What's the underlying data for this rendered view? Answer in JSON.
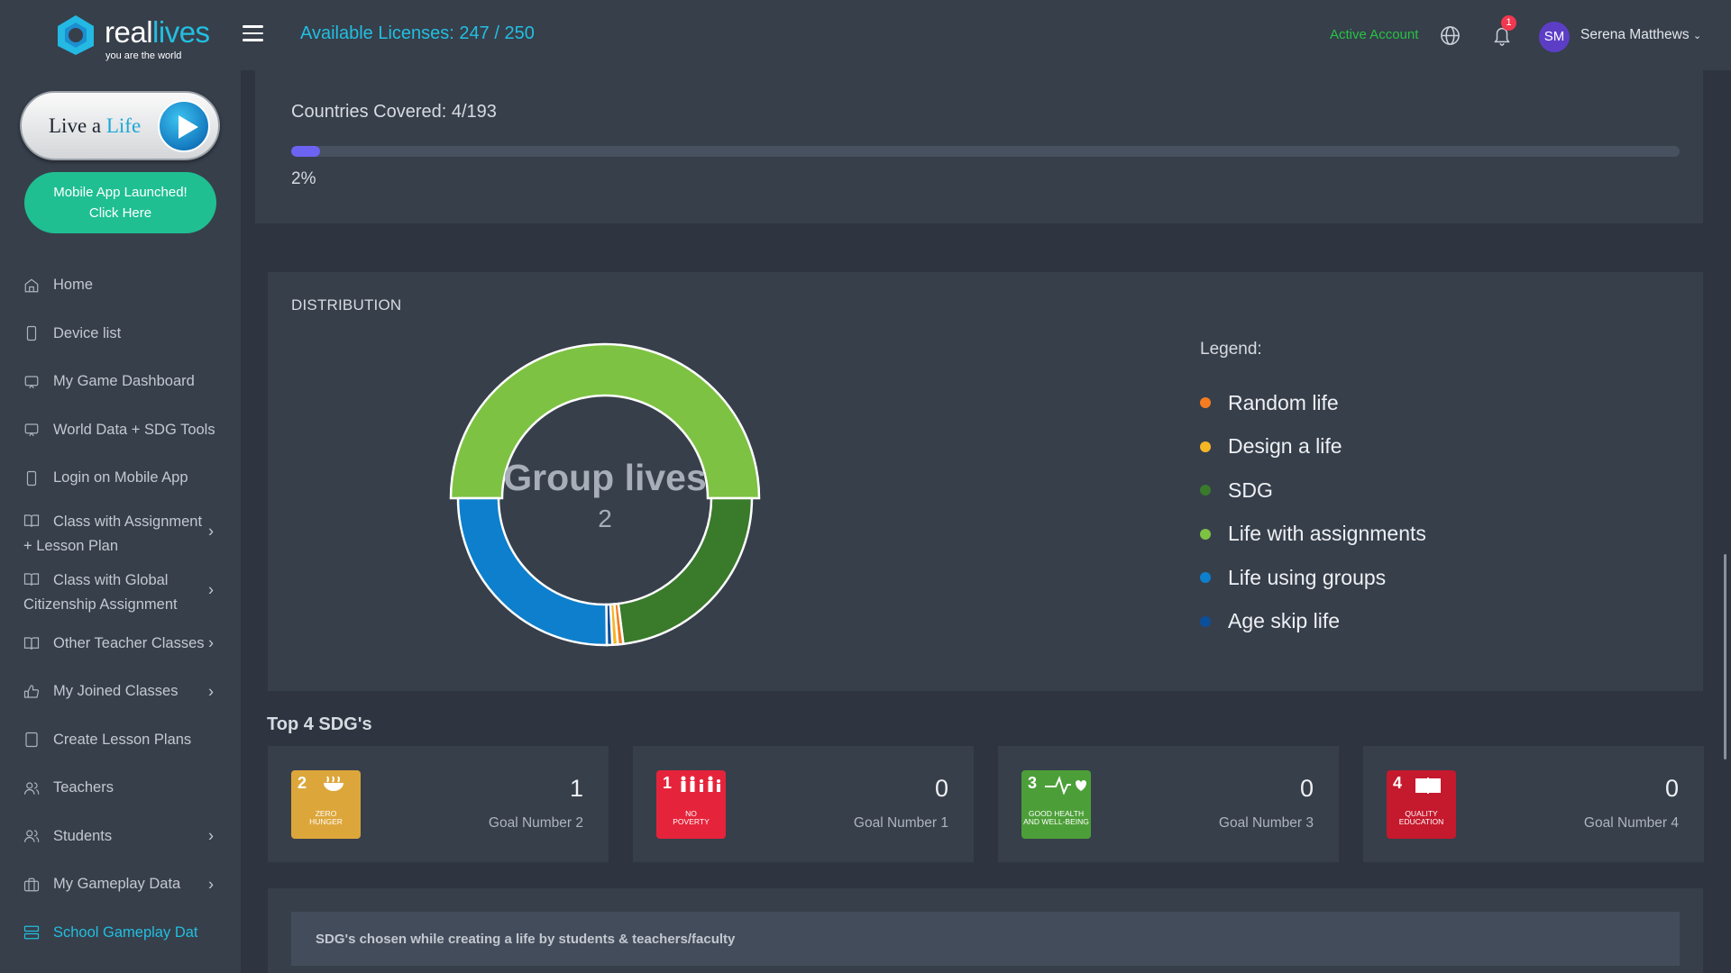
{
  "brand": {
    "name_part1": "real",
    "name_part2": "lives",
    "tagline": "you are the world"
  },
  "sidebar": {
    "live_button": {
      "label_part1": "Live a ",
      "label_part2": "Life"
    },
    "mobile_button": {
      "line1": "Mobile App Launched!",
      "line2": "Click Here"
    },
    "items": [
      {
        "label": "Home",
        "icon": "home-icon"
      },
      {
        "label": "Device list",
        "icon": "device-icon"
      },
      {
        "label": "My Game Dashboard",
        "icon": "monitor-icon"
      },
      {
        "label": "World Data + SDG Tools",
        "icon": "monitor-icon"
      },
      {
        "label": "Login on Mobile App",
        "icon": "mobile-icon"
      },
      {
        "label": "Class with Assignment",
        "label2": "+ Lesson Plan",
        "icon": "book-icon",
        "chevron": true
      },
      {
        "label": "Class with Global",
        "label2": "Citizenship Assignment",
        "icon": "book-icon",
        "chevron": true
      },
      {
        "label": "Other Teacher Classes",
        "icon": "book-icon",
        "chevron": true
      },
      {
        "label": "My Joined Classes",
        "icon": "thumbs-up-icon",
        "chevron": true
      },
      {
        "label": "Create Lesson Plans",
        "icon": "tablet-icon"
      },
      {
        "label": "Teachers",
        "icon": "users-icon"
      },
      {
        "label": "Students",
        "icon": "users-icon",
        "chevron": true
      },
      {
        "label": "My Gameplay Data",
        "icon": "briefcase-icon",
        "chevron": true
      },
      {
        "label": "School Gameplay Dat",
        "icon": "server-icon",
        "active": true
      }
    ]
  },
  "topbar": {
    "licenses": "Available Licenses: 247 / 250",
    "account_status": "Active Account",
    "notification_count": "1",
    "user_initials": "SM",
    "user_name": "Serena Matthews"
  },
  "countries": {
    "title": "Countries Covered: 4/193",
    "percent_label": "2%",
    "progress_fraction": 0.021
  },
  "distribution": {
    "title": "DISTRIBUTION",
    "center_title": "Group lives",
    "center_value": "2",
    "legend_heading": "Legend:",
    "legend": [
      {
        "label": "Random life",
        "color": "#f57c20"
      },
      {
        "label": "Design a life",
        "color": "#f5b626"
      },
      {
        "label": "SDG",
        "color": "#3a7a2b"
      },
      {
        "label": "Life with assignments",
        "color": "#7dc242"
      },
      {
        "label": "Life using groups",
        "color": "#0e7fcc"
      },
      {
        "label": "Age skip life",
        "color": "#0b4e9a"
      }
    ]
  },
  "chart_data": {
    "type": "pie",
    "title": "DISTRIBUTION",
    "series": [
      {
        "name": "Life with assignments",
        "value": 50,
        "color": "#7dc242"
      },
      {
        "name": "SDG",
        "value": 23,
        "color": "#3a7a2b"
      },
      {
        "name": "Random life",
        "value": 0.6,
        "color": "#f57c20"
      },
      {
        "name": "Design a life",
        "value": 0.6,
        "color": "#f5b626"
      },
      {
        "name": "Age skip life",
        "value": 0.6,
        "color": "#0b4e9a"
      },
      {
        "name": "Life using groups",
        "value": 25.2,
        "color": "#0e7fcc"
      }
    ],
    "highlighted": "Life with assignments"
  },
  "top_sdgs": {
    "title": "Top 4 SDG's",
    "cards": [
      {
        "sdg_number": "2",
        "sdg_name_line1": "ZERO",
        "sdg_name_line2": "HUNGER",
        "color": "#dda63a",
        "value": "1",
        "label": "Goal Number 2",
        "icon": "bowl-icon"
      },
      {
        "sdg_number": "1",
        "sdg_name_line1": "NO",
        "sdg_name_line2": "POVERTY",
        "color": "#e5243b",
        "value": "0",
        "label": "Goal Number 1",
        "icon": "family-icon"
      },
      {
        "sdg_number": "3",
        "sdg_name_line1": "GOOD HEALTH",
        "sdg_name_line2": "AND WELL-BEING",
        "color": "#4c9f38",
        "value": "0",
        "label": "Goal Number 3",
        "icon": "heartbeat-icon"
      },
      {
        "sdg_number": "4",
        "sdg_name_line1": "QUALITY",
        "sdg_name_line2": "EDUCATION",
        "color": "#c5192d",
        "value": "0",
        "label": "Goal Number 4",
        "icon": "book-icon"
      }
    ]
  },
  "chosen_section": {
    "caption": "SDG's chosen while creating a life by students & teachers/faculty"
  }
}
